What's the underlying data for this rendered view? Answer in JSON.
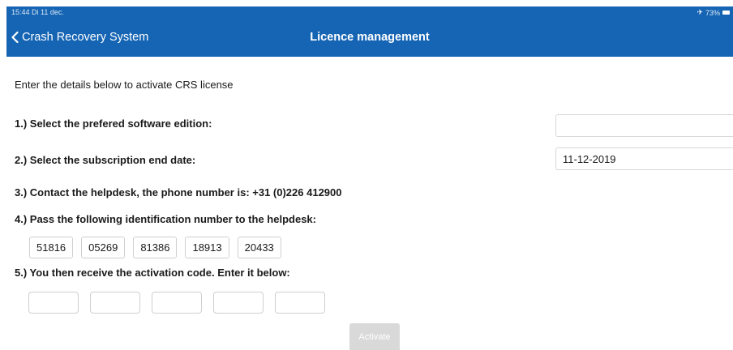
{
  "status_bar": {
    "time": "15:44  Di 11 dec.",
    "battery": "73%"
  },
  "nav": {
    "back_label": "Crash Recovery System",
    "title": "Licence management",
    "color": "#1565b4"
  },
  "form": {
    "intro": "Enter the details below to activate CRS license",
    "step1": "1.) Select the prefered software edition:",
    "edition_value": "",
    "step2": "2.) Select the subscription end date:",
    "end_date": "11-12-2019",
    "step3": "3.) Contact the helpdesk, the phone number is: +31 (0)226 412900",
    "step4": "4.) Pass the following identification number to the helpdesk:",
    "id_parts": [
      "51816",
      "05269",
      "81386",
      "18913",
      "20433"
    ],
    "step5": "5.) You then receive the activation code. Enter it below:",
    "activation_code": [
      "",
      "",
      "",
      "",
      ""
    ],
    "activate_label": "Activate"
  },
  "icons": {
    "back": "chevron-left-icon",
    "airplane": "airplane-icon",
    "battery": "battery-icon"
  }
}
